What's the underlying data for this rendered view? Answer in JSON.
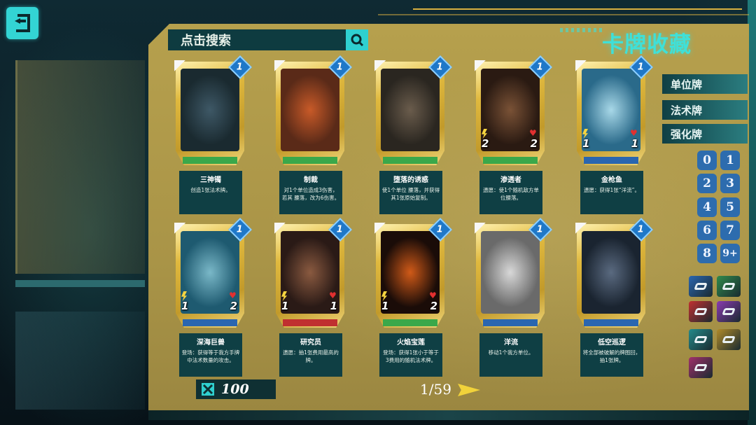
{
  "header": {
    "title": "卡牌收藏",
    "search_placeholder": "点击搜索"
  },
  "type_tabs": [
    {
      "label": "单位牌"
    },
    {
      "label": "法术牌"
    },
    {
      "label": "强化牌"
    }
  ],
  "cost_filters": [
    "0",
    "1",
    "2",
    "3",
    "4",
    "5",
    "6",
    "7",
    "8",
    "9+"
  ],
  "faction_filters": [
    {
      "icon": "faction-blue-wave-icon",
      "color": "#2a66b0"
    },
    {
      "icon": "faction-green-leaf-icon",
      "color": "#2f8a4c"
    },
    {
      "icon": "faction-red-claw-icon",
      "color": "#c03030"
    },
    {
      "icon": "faction-purple-crystal-icon",
      "color": "#8a3ab0"
    },
    {
      "icon": "faction-teal-swirl-icon",
      "color": "#248a8a"
    },
    {
      "icon": "faction-gold-fan-icon",
      "color": "#b08a2a"
    },
    {
      "icon": "faction-magenta-gem-icon",
      "color": "#a0306a"
    }
  ],
  "cards": [
    {
      "cost": "1",
      "name": "三神镯",
      "text": "创造1张法术牌。",
      "attack": "",
      "health": "",
      "art": [
        "#1a2a30",
        "#3e5866"
      ],
      "base": "#3aa84a"
    },
    {
      "cost": "1",
      "name": "制裁",
      "text": "对1个单位造成3伤害，若其 腰落，改为6伤害。",
      "attack": "",
      "health": "",
      "art": [
        "#5a2a18",
        "#c85a28"
      ],
      "base": "#3aa84a"
    },
    {
      "cost": "1",
      "name": "堕落的诱惑",
      "text": "使1个单位 腰落，并获得其1张原始复制。",
      "attack": "",
      "health": "",
      "art": [
        "#2a2620",
        "#6a5c4c"
      ],
      "base": "#3aa84a"
    },
    {
      "cost": "1",
      "name": "渗透者",
      "text": "遗愿：使1个随机敌方单位腰落。",
      "attack": "2",
      "health": "2",
      "art": [
        "#2a1a12",
        "#7a5236"
      ],
      "base": "#3aa84a"
    },
    {
      "cost": "1",
      "name": "金枪鱼",
      "text": "遗愿：获得1张“洋流”。",
      "attack": "1",
      "health": "1",
      "art": [
        "#2a6a8a",
        "#a8d8e8"
      ],
      "base": "#2a66b0"
    },
    {
      "cost": "1",
      "name": "深海巨兽",
      "text": "登场：获得等于我方手牌中法术数量的攻击。",
      "attack": "1",
      "health": "2",
      "art": [
        "#1e5a70",
        "#7ab8c8"
      ],
      "base": "#2a66b0"
    },
    {
      "cost": "1",
      "name": "研究员",
      "text": "遗愿：抽1张费用最高的牌。",
      "attack": "1",
      "health": "1",
      "art": [
        "#2a1a16",
        "#8a5a40"
      ],
      "base": "#c03030"
    },
    {
      "cost": "1",
      "name": "火焰宝莲",
      "text": "登场：获得1张小于等于3费用的随机法术牌。",
      "attack": "1",
      "health": "2",
      "art": [
        "#1a0c08",
        "#d05a18"
      ],
      "base": "#3aa84a"
    },
    {
      "cost": "1",
      "name": "洋流",
      "text": "移动1个我方单位。",
      "attack": "",
      "health": "",
      "art": [
        "#6a6a6a",
        "#d8d8d8"
      ],
      "base": "#2a66b0"
    },
    {
      "cost": "1",
      "name": "低空巡逻",
      "text": "将全部被破解的牌图回，抽1张牌。",
      "attack": "",
      "health": "",
      "art": [
        "#1a2430",
        "#5a6a80"
      ],
      "base": "#2a66b0"
    }
  ],
  "footer": {
    "currency": "100",
    "page": "1/59"
  },
  "colors": {
    "accent": "#3fe0d8",
    "frame_gold": "#b6a04d",
    "panel_teal": "#0f3f44",
    "cost_button": "#2d6cae",
    "page_arrow": "#f1d23a"
  }
}
